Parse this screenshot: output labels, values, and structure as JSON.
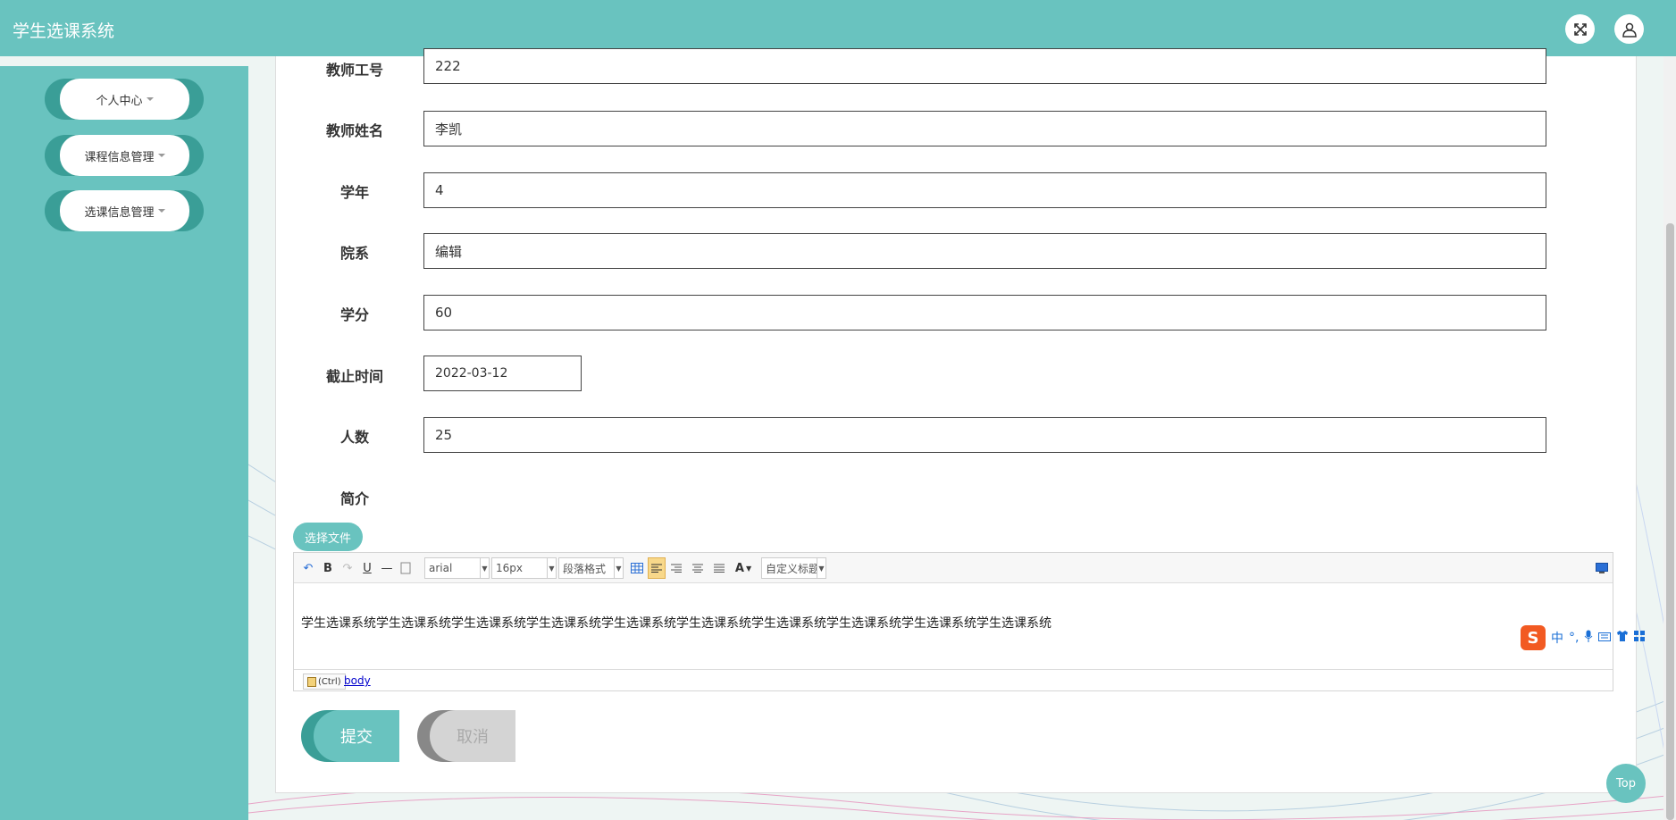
{
  "app": {
    "title": "学生选课系统"
  },
  "header": {
    "fullscreen_icon": "fullscreen-icon",
    "user_icon": "user-icon"
  },
  "sidebar": {
    "items": [
      {
        "label": "个人中心"
      },
      {
        "label": "课程信息管理"
      },
      {
        "label": "选课信息管理"
      }
    ]
  },
  "form": {
    "fields": [
      {
        "label": "教师工号",
        "value": "222"
      },
      {
        "label": "教师姓名",
        "value": "李凯"
      },
      {
        "label": "学年",
        "value": "4"
      },
      {
        "label": "院系",
        "value": "编辑"
      },
      {
        "label": "学分",
        "value": "60"
      },
      {
        "label": "截止时间",
        "value": "2022-03-12"
      },
      {
        "label": "人数",
        "value": "25"
      }
    ],
    "intro_label": "简介",
    "file_button": "选择文件"
  },
  "editor": {
    "toolbar": {
      "bold": "B",
      "underline": "U",
      "font_family": "arial",
      "font_size": "16px",
      "paragraph": "段落格式",
      "font_color": "A",
      "custom_title": "自定义标题"
    },
    "content": "学生选课系统学生选课系统学生选课系统学生选课系统学生选课系统学生选课系统学生选课系统学生选课系统学生选课系统学生选课系统",
    "status_path": "body",
    "paste_tip": "(Ctrl)"
  },
  "actions": {
    "submit": "提交",
    "cancel": "取消"
  },
  "back_to_top": "Top",
  "ime": {
    "lang": "中",
    "punct": "°,"
  },
  "colors": {
    "primary": "#69c3bf",
    "primary_dark": "#3a9e97",
    "cancel_bg": "#d4d4d4",
    "cancel_dark": "#888888"
  }
}
